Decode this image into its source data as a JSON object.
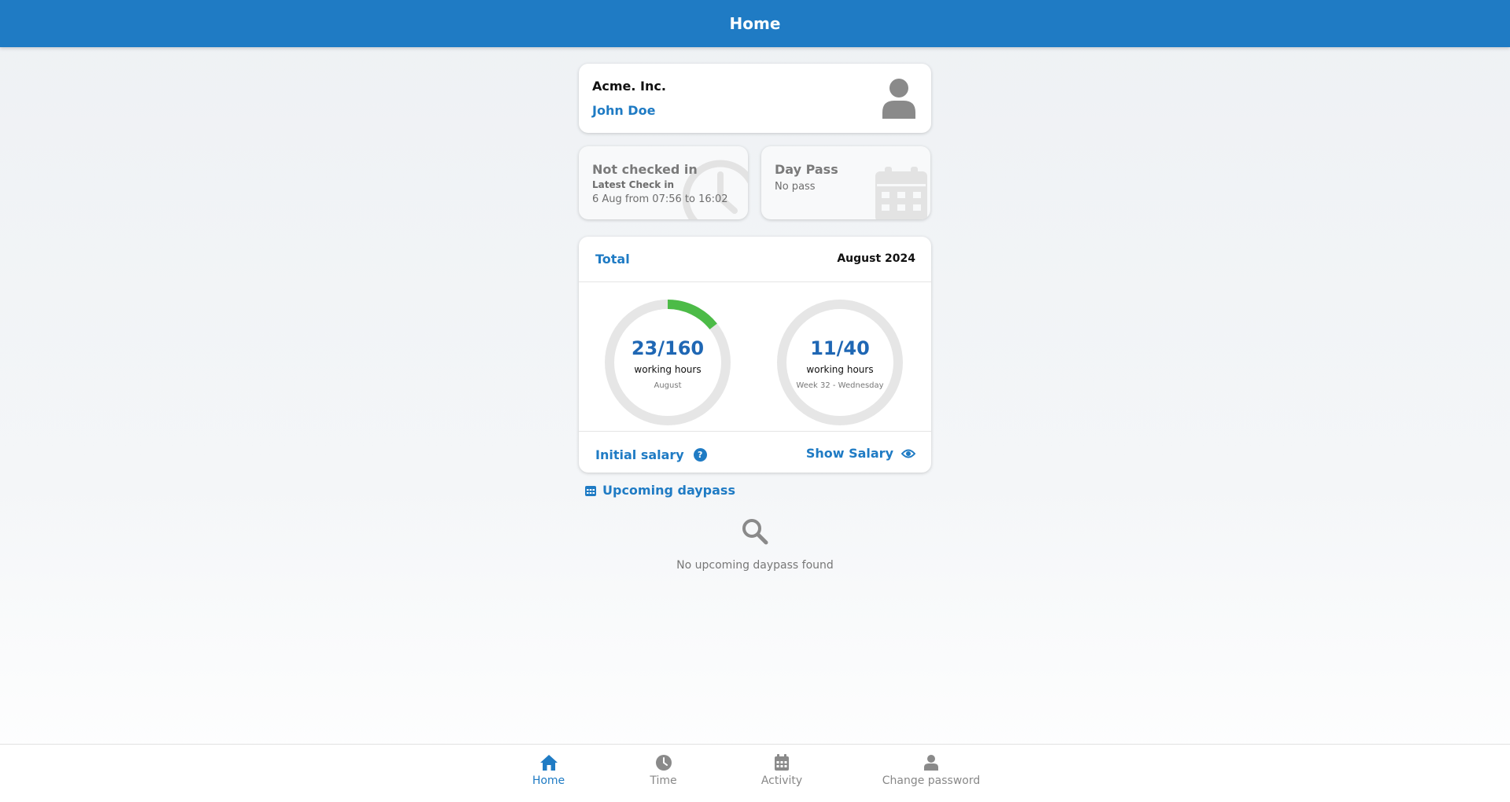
{
  "header": {
    "title": "Home"
  },
  "profile": {
    "company": "Acme. Inc.",
    "user_name": "John Doe"
  },
  "checkin": {
    "status": "Not checked in",
    "latest_label": "Latest Check in",
    "latest_value": "6 Aug from 07:56 to 16:02"
  },
  "daypass": {
    "title": "Day Pass",
    "status": "No pass"
  },
  "total": {
    "label": "Total",
    "period": "August 2024",
    "monthly": {
      "value": "23/160",
      "unit": "working hours",
      "period": "August",
      "done": 23,
      "goal": 160
    },
    "weekly": {
      "value": "11/40",
      "unit": "working hours",
      "period": "Week 32 - Wednesday",
      "done": 11,
      "goal": 40
    },
    "initial_salary_label": "Initial salary",
    "show_salary_label": "Show Salary",
    "help_symbol": "?"
  },
  "upcoming": {
    "title": "Upcoming daypass",
    "empty_text": "No upcoming daypass found"
  },
  "nav": {
    "items": [
      {
        "label": "Home",
        "icon": "home-icon",
        "active": true
      },
      {
        "label": "Time",
        "icon": "clock-icon",
        "active": false
      },
      {
        "label": "Activity",
        "icon": "calendar-icon",
        "active": false
      },
      {
        "label": "Change password",
        "icon": "user-icon",
        "active": false
      }
    ]
  },
  "colors": {
    "primary": "#1f7bc4",
    "progress": "#4cbb47",
    "ring_track": "#e6e6e6"
  }
}
